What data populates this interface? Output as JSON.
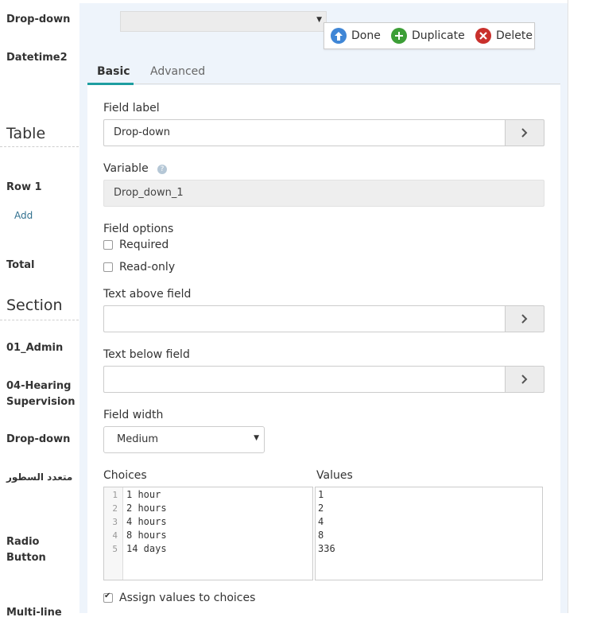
{
  "sidebar": {
    "items": [
      {
        "label": "Drop-down"
      },
      {
        "label": "Datetime2"
      },
      {
        "label": "Table"
      },
      {
        "label": "Row 1"
      },
      {
        "label": "Add"
      },
      {
        "label": "Total"
      },
      {
        "label": "Section"
      },
      {
        "label": "01_Admin"
      },
      {
        "label": "04-Hearing Supervision"
      },
      {
        "label": "Drop-down"
      },
      {
        "label": "متعدد السطور"
      },
      {
        "label": "Radio Button"
      },
      {
        "label": "Multi-line"
      }
    ]
  },
  "actions": {
    "done": "Done",
    "duplicate": "Duplicate",
    "delete": "Delete"
  },
  "tabs": {
    "basic": "Basic",
    "advanced": "Advanced"
  },
  "form": {
    "field_label": {
      "label": "Field label",
      "value": "Drop-down"
    },
    "variable": {
      "label": "Variable",
      "value": "Drop_down_1"
    },
    "field_options": {
      "label": "Field options",
      "required": "Required",
      "read_only": "Read-only"
    },
    "text_above": {
      "label": "Text above field",
      "value": ""
    },
    "text_below": {
      "label": "Text below field",
      "value": ""
    },
    "field_width": {
      "label": "Field width",
      "value": "Medium"
    },
    "choices": {
      "label": "Choices",
      "lines": [
        "1 hour",
        "2 hours",
        "4 hours",
        "8 hours",
        "14 days"
      ],
      "line_numbers": [
        "1",
        "2",
        "3",
        "4",
        "5"
      ]
    },
    "values": {
      "label": "Values",
      "lines": [
        "1",
        "2",
        "4",
        "8",
        "336"
      ]
    },
    "assign_values": "Assign values to choices"
  },
  "icons": {
    "done": "arrow-up-circle-icon",
    "duplicate": "plus-circle-icon",
    "delete": "x-circle-icon",
    "help": "question-circle-icon",
    "arrow": "chevron-right-icon"
  },
  "colors": {
    "accent": "#1e9ea1",
    "done": "#3f86d6",
    "duplicate": "#3c9e37",
    "delete": "#c9302c",
    "link": "#31708f"
  }
}
